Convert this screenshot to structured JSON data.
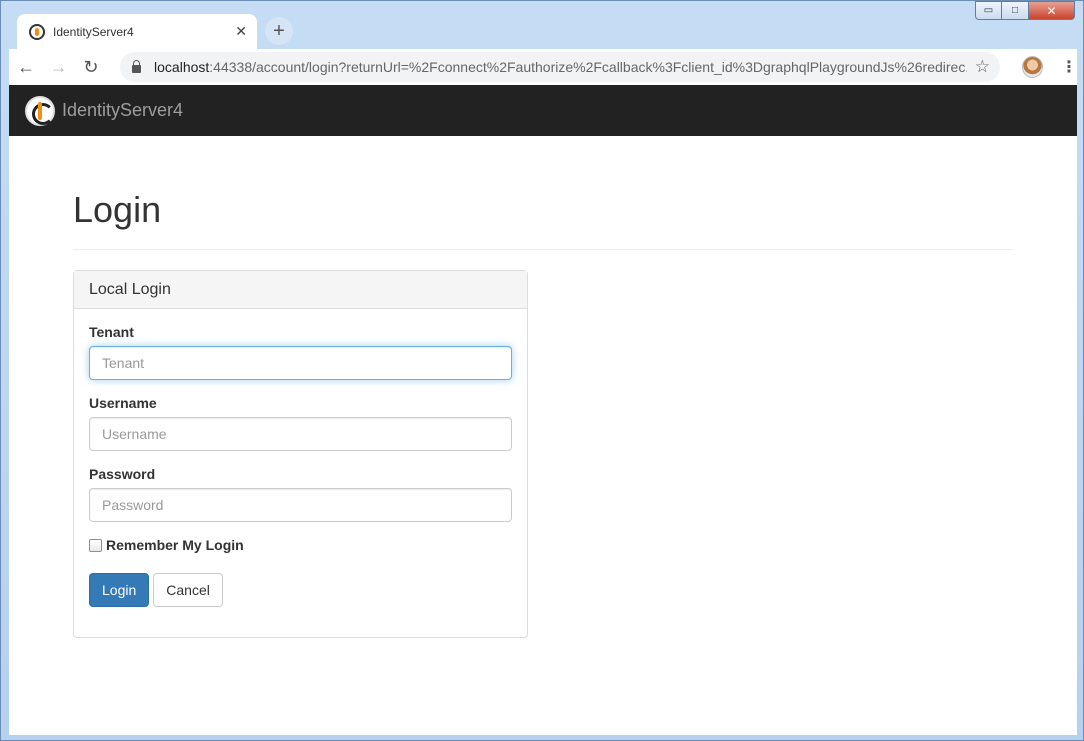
{
  "window": {
    "minimize_glyph": "▭",
    "maximize_glyph": "□",
    "close_glyph": "✕"
  },
  "browser": {
    "tab_title": "IdentityServer4",
    "tab_close_glyph": "✕",
    "new_tab_glyph": "+",
    "back_glyph": "←",
    "forward_glyph": "→",
    "reload_glyph": "↻",
    "url_host": "localhost",
    "url_rest": ":44338/account/login?returnUrl=%2Fconnect%2Fauthorize%2Fcallback%3Fclient_id%3DgraphqlPlaygroundJs%26redirec...",
    "star_glyph": "☆",
    "menu_glyph": "⋮",
    "icons": {
      "favicon": "identityserver-logo-icon",
      "lock": "lock-icon",
      "star": "star-icon",
      "avatar": "profile-avatar"
    }
  },
  "navbar": {
    "brand": "IdentityServer4"
  },
  "page": {
    "title": "Login"
  },
  "panel": {
    "heading": "Local Login",
    "tenant": {
      "label": "Tenant",
      "placeholder": "Tenant",
      "value": ""
    },
    "username": {
      "label": "Username",
      "placeholder": "Username",
      "value": ""
    },
    "password": {
      "label": "Password",
      "placeholder": "Password",
      "value": ""
    },
    "remember": {
      "label": "Remember My Login",
      "checked": false
    },
    "login_button": "Login",
    "cancel_button": "Cancel"
  },
  "colors": {
    "navbar_bg": "#222222",
    "primary": "#337ab7",
    "focus": "#66afe9"
  }
}
